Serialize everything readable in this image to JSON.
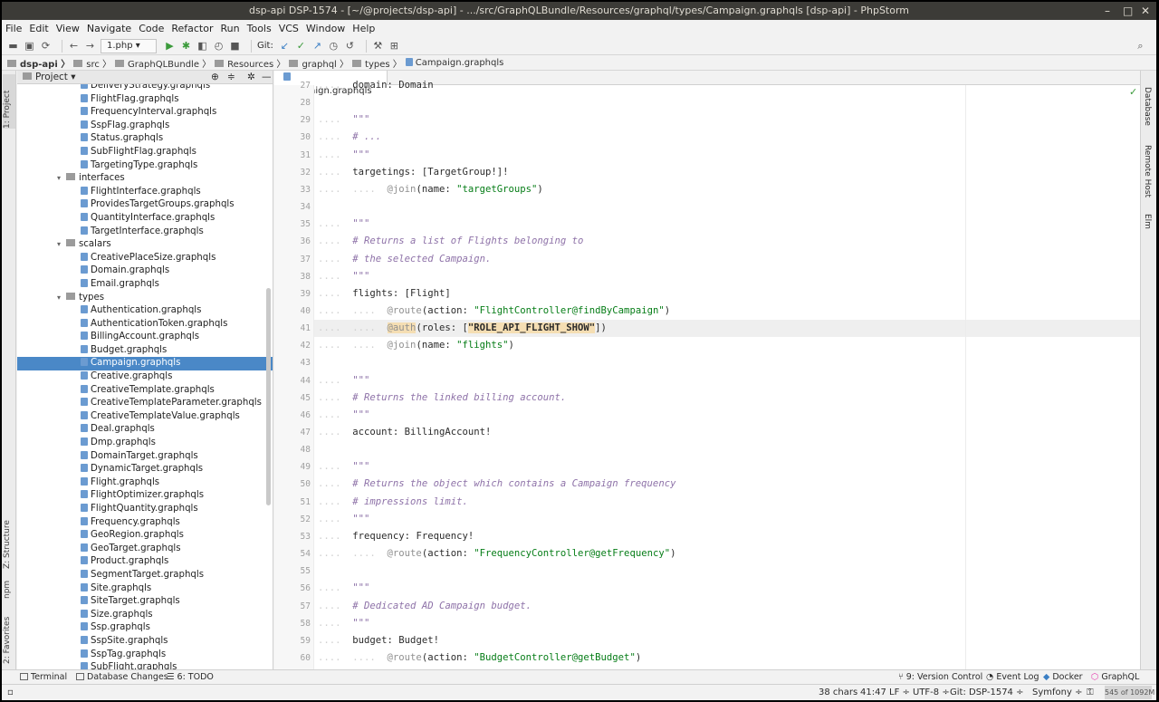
{
  "window": {
    "title": "dsp-api DSP-1574 - [~/@projects/dsp-api] - .../src/GraphQLBundle/Resources/graphql/types/Campaign.graphqls [dsp-api] - PhpStorm",
    "minimize": "–",
    "maximize": "□",
    "close": "✕"
  },
  "menu": [
    "File",
    "Edit",
    "View",
    "Navigate",
    "Code",
    "Refactor",
    "Run",
    "Tools",
    "VCS",
    "Window",
    "Help"
  ],
  "toolbar": {
    "run_config": "1.php",
    "git_label": "Git:"
  },
  "breadcrumb": [
    "dsp-api",
    "src",
    "GraphQLBundle",
    "Resources",
    "graphql",
    "types",
    "Campaign.graphqls"
  ],
  "left_strip": {
    "project": "1: Project",
    "structure": "Z: Structure",
    "npm": "npm",
    "favorites": "2: Favorites"
  },
  "project_panel": {
    "title": "Project",
    "dropdown": "▾",
    "tree": [
      {
        "type": "file",
        "label": "DeliveryStrategy.graphqls",
        "indent": 3
      },
      {
        "type": "file",
        "label": "FlightFlag.graphqls",
        "indent": 3
      },
      {
        "type": "file",
        "label": "FrequencyInterval.graphqls",
        "indent": 3
      },
      {
        "type": "file",
        "label": "SspFlag.graphqls",
        "indent": 3
      },
      {
        "type": "file",
        "label": "Status.graphqls",
        "indent": 3
      },
      {
        "type": "file",
        "label": "SubFlightFlag.graphqls",
        "indent": 3
      },
      {
        "type": "file",
        "label": "TargetingType.graphqls",
        "indent": 3
      },
      {
        "type": "dir",
        "label": "interfaces",
        "indent": 2
      },
      {
        "type": "file",
        "label": "FlightInterface.graphqls",
        "indent": 3
      },
      {
        "type": "file",
        "label": "ProvidesTargetGroups.graphqls",
        "indent": 3
      },
      {
        "type": "file",
        "label": "QuantityInterface.graphqls",
        "indent": 3
      },
      {
        "type": "file",
        "label": "TargetInterface.graphqls",
        "indent": 3
      },
      {
        "type": "dir",
        "label": "scalars",
        "indent": 2
      },
      {
        "type": "file",
        "label": "CreativePlaceSize.graphqls",
        "indent": 3
      },
      {
        "type": "file",
        "label": "Domain.graphqls",
        "indent": 3
      },
      {
        "type": "file",
        "label": "Email.graphqls",
        "indent": 3
      },
      {
        "type": "dir",
        "label": "types",
        "indent": 2
      },
      {
        "type": "file",
        "label": "Authentication.graphqls",
        "indent": 3
      },
      {
        "type": "file",
        "label": "AuthenticationToken.graphqls",
        "indent": 3
      },
      {
        "type": "file",
        "label": "BillingAccount.graphqls",
        "indent": 3
      },
      {
        "type": "file",
        "label": "Budget.graphqls",
        "indent": 3
      },
      {
        "type": "file",
        "label": "Campaign.graphqls",
        "indent": 3,
        "selected": true
      },
      {
        "type": "file",
        "label": "Creative.graphqls",
        "indent": 3
      },
      {
        "type": "file",
        "label": "CreativeTemplate.graphqls",
        "indent": 3
      },
      {
        "type": "file",
        "label": "CreativeTemplateParameter.graphqls",
        "indent": 3
      },
      {
        "type": "file",
        "label": "CreativeTemplateValue.graphqls",
        "indent": 3
      },
      {
        "type": "file",
        "label": "Deal.graphqls",
        "indent": 3
      },
      {
        "type": "file",
        "label": "Dmp.graphqls",
        "indent": 3
      },
      {
        "type": "file",
        "label": "DomainTarget.graphqls",
        "indent": 3
      },
      {
        "type": "file",
        "label": "DynamicTarget.graphqls",
        "indent": 3
      },
      {
        "type": "file",
        "label": "Flight.graphqls",
        "indent": 3
      },
      {
        "type": "file",
        "label": "FlightOptimizer.graphqls",
        "indent": 3
      },
      {
        "type": "file",
        "label": "FlightQuantity.graphqls",
        "indent": 3
      },
      {
        "type": "file",
        "label": "Frequency.graphqls",
        "indent": 3
      },
      {
        "type": "file",
        "label": "GeoRegion.graphqls",
        "indent": 3
      },
      {
        "type": "file",
        "label": "GeoTarget.graphqls",
        "indent": 3
      },
      {
        "type": "file",
        "label": "Product.graphqls",
        "indent": 3
      },
      {
        "type": "file",
        "label": "SegmentTarget.graphqls",
        "indent": 3
      },
      {
        "type": "file",
        "label": "Site.graphqls",
        "indent": 3
      },
      {
        "type": "file",
        "label": "SiteTarget.graphqls",
        "indent": 3
      },
      {
        "type": "file",
        "label": "Size.graphqls",
        "indent": 3
      },
      {
        "type": "file",
        "label": "Ssp.graphqls",
        "indent": 3
      },
      {
        "type": "file",
        "label": "SspSite.graphqls",
        "indent": 3
      },
      {
        "type": "file",
        "label": "SspTag.graphqls",
        "indent": 3
      },
      {
        "type": "file",
        "label": "SubFlight.graphqls",
        "indent": 3
      }
    ]
  },
  "editor": {
    "tab": "Campaign.graphqls",
    "lines": [
      {
        "n": "27",
        "indent": 1,
        "parts": [
          [
            "p",
            "domain: Domain"
          ]
        ]
      },
      {
        "n": "28",
        "indent": 0,
        "parts": []
      },
      {
        "n": "29",
        "indent": 1,
        "parts": [
          [
            "c",
            "\"\"\""
          ]
        ]
      },
      {
        "n": "30",
        "indent": 1,
        "parts": [
          [
            "c",
            "# ..."
          ]
        ]
      },
      {
        "n": "31",
        "indent": 1,
        "parts": [
          [
            "c",
            "\"\"\""
          ]
        ]
      },
      {
        "n": "32",
        "indent": 1,
        "parts": [
          [
            "p",
            "targetings: [TargetGroup!]!"
          ]
        ]
      },
      {
        "n": "33",
        "indent": 2,
        "parts": [
          [
            "d",
            "@join"
          ],
          [
            "p",
            "(name: "
          ],
          [
            "s",
            "\"targetGroups\""
          ],
          [
            "p",
            ")"
          ]
        ]
      },
      {
        "n": "34",
        "indent": 0,
        "parts": []
      },
      {
        "n": "35",
        "indent": 1,
        "parts": [
          [
            "c",
            "\"\"\""
          ]
        ]
      },
      {
        "n": "36",
        "indent": 1,
        "parts": [
          [
            "c",
            "# Returns a list of Flights belonging to"
          ]
        ]
      },
      {
        "n": "37",
        "indent": 1,
        "parts": [
          [
            "c",
            "# the selected Campaign."
          ]
        ]
      },
      {
        "n": "38",
        "indent": 1,
        "parts": [
          [
            "c",
            "\"\"\""
          ]
        ]
      },
      {
        "n": "39",
        "indent": 1,
        "parts": [
          [
            "p",
            "flights: [Flight]"
          ]
        ]
      },
      {
        "n": "40",
        "indent": 2,
        "parts": [
          [
            "d",
            "@route"
          ],
          [
            "p",
            "(action: "
          ],
          [
            "s",
            "\"FlightController@findByCampaign\""
          ],
          [
            "p",
            ")"
          ]
        ]
      },
      {
        "n": "41",
        "indent": 2,
        "hl": true,
        "parts": [
          [
            "d",
            "@auth"
          ],
          [
            "p",
            "(roles: ["
          ],
          [
            "s",
            "\"ROLE_API_FLIGHT_SHOW\""
          ],
          [
            "p",
            "])"
          ]
        ]
      },
      {
        "n": "42",
        "indent": 2,
        "parts": [
          [
            "d",
            "@join"
          ],
          [
            "p",
            "(name: "
          ],
          [
            "s",
            "\"flights\""
          ],
          [
            "p",
            ")"
          ]
        ]
      },
      {
        "n": "43",
        "indent": 0,
        "parts": []
      },
      {
        "n": "44",
        "indent": 1,
        "parts": [
          [
            "c",
            "\"\"\""
          ]
        ]
      },
      {
        "n": "45",
        "indent": 1,
        "parts": [
          [
            "c",
            "# Returns the linked billing account."
          ]
        ]
      },
      {
        "n": "46",
        "indent": 1,
        "parts": [
          [
            "c",
            "\"\"\""
          ]
        ]
      },
      {
        "n": "47",
        "indent": 1,
        "parts": [
          [
            "p",
            "account: BillingAccount!"
          ]
        ]
      },
      {
        "n": "48",
        "indent": 0,
        "parts": []
      },
      {
        "n": "49",
        "indent": 1,
        "parts": [
          [
            "c",
            "\"\"\""
          ]
        ]
      },
      {
        "n": "50",
        "indent": 1,
        "parts": [
          [
            "c",
            "# Returns the object which contains a Campaign frequency"
          ]
        ]
      },
      {
        "n": "51",
        "indent": 1,
        "parts": [
          [
            "c",
            "# impressions limit."
          ]
        ]
      },
      {
        "n": "52",
        "indent": 1,
        "parts": [
          [
            "c",
            "\"\"\""
          ]
        ]
      },
      {
        "n": "53",
        "indent": 1,
        "parts": [
          [
            "p",
            "frequency: Frequency!"
          ]
        ]
      },
      {
        "n": "54",
        "indent": 2,
        "parts": [
          [
            "d",
            "@route"
          ],
          [
            "p",
            "(action: "
          ],
          [
            "s",
            "\"FrequencyController@getFrequency\""
          ],
          [
            "p",
            ")"
          ]
        ]
      },
      {
        "n": "55",
        "indent": 0,
        "parts": []
      },
      {
        "n": "56",
        "indent": 1,
        "parts": [
          [
            "c",
            "\"\"\""
          ]
        ]
      },
      {
        "n": "57",
        "indent": 1,
        "parts": [
          [
            "c",
            "# Dedicated AD Campaign budget."
          ]
        ]
      },
      {
        "n": "58",
        "indent": 1,
        "parts": [
          [
            "c",
            "\"\"\""
          ]
        ]
      },
      {
        "n": "59",
        "indent": 1,
        "parts": [
          [
            "p",
            "budget: Budget!"
          ]
        ]
      },
      {
        "n": "60",
        "indent": 2,
        "parts": [
          [
            "d",
            "@route"
          ],
          [
            "p",
            "(action: "
          ],
          [
            "s",
            "\"BudgetController@getBudget\""
          ],
          [
            "p",
            ")"
          ]
        ]
      }
    ]
  },
  "right_strip": {
    "database": "Database",
    "remote_host": "Remote Host",
    "elm": "Elm"
  },
  "tool_windows": {
    "terminal": "Terminal",
    "database_changes": "Database Changes",
    "todo": "6: TODO",
    "version_control": "9: Version Control",
    "event_log": "Event Log",
    "docker": "Docker",
    "graphql": "GraphQL"
  },
  "status_bar": {
    "chars": "38 chars",
    "position": "41:47",
    "line_sep": "LF ÷",
    "encoding": "UTF-8 ÷",
    "git": "Git: DSP-1574 ÷",
    "framework": "Symfony ÷",
    "memory": "545 of 1092M"
  },
  "colors": {
    "selection": "#4a88c7",
    "comment": "#8e72a8",
    "string": "#067d17",
    "directive": "#909090",
    "titlebar": "#3c3b37"
  }
}
